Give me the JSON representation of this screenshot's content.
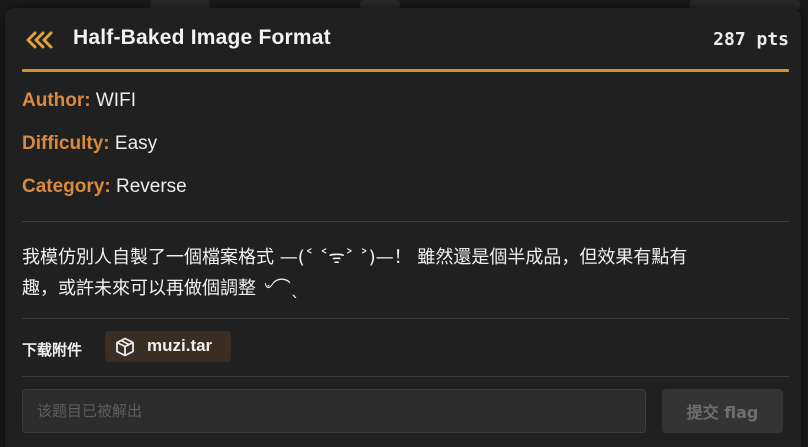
{
  "header": {
    "title": "Half-Baked Image Format",
    "points": "287 pts"
  },
  "meta": [
    {
      "key": "Author:",
      "value": "WIFI"
    },
    {
      "key": "Difficulty:",
      "value": "Easy"
    },
    {
      "key": "Category:",
      "value": "Reverse"
    }
  ],
  "description": {
    "line1": "我模仿別人自製了一個檔案格式 —(˂ ˂ᯤ˃ ˃)—！ 雖然還是個半成品，但效果有點有",
    "line2": "趣，或許未來可以再做個調整 ৺⌒ˎ"
  },
  "attachment": {
    "label": "下载附件",
    "filename": "muzi.tar"
  },
  "flag_form": {
    "placeholder": "该题目已被解出",
    "value": "",
    "submit_label": "提交 flag"
  },
  "colors": {
    "accent": "#d8902e",
    "meta_key": "#d98a3f",
    "modal_bg": "#202020",
    "chip_bg": "#3a2d24"
  },
  "icons": {
    "back": "triple-chevron-left-icon",
    "file": "package-box-icon"
  }
}
